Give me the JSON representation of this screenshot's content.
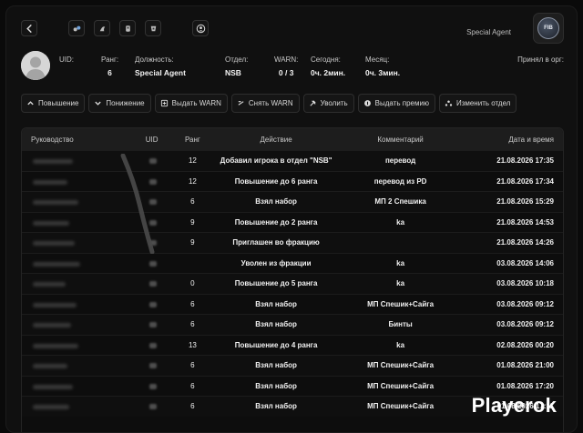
{
  "header": {
    "role_tag": "Special Agent",
    "logo_text": "FIB",
    "nav_icons": [
      "back-arrow-icon",
      "faction-icon-1",
      "faction-icon-2",
      "faction-icon-3",
      "faction-icon-4",
      "profile-icon"
    ]
  },
  "profile": {
    "uid_label": "UID:",
    "uid_value": "",
    "rank_label": "Ранг:",
    "rank_value": "6",
    "position_label": "Должность:",
    "position_value": "Special Agent",
    "dept_label": "Отдел:",
    "dept_value": "NSB",
    "warn_label": "WARN:",
    "warn_value": "0 / 3",
    "today_label": "Сегодня:",
    "today_value": "0ч. 2мин.",
    "month_label": "Месяц:",
    "month_value": "0ч. 3мин.",
    "joined_label": "Принял в орг:",
    "joined_value": ""
  },
  "actions": [
    {
      "label": "Повышение",
      "icon": "chevron-up-icon"
    },
    {
      "label": "Понижение",
      "icon": "chevron-down-icon"
    },
    {
      "label": "Выдать WARN",
      "icon": "warn-add-icon"
    },
    {
      "label": "Снять WARN",
      "icon": "warn-remove-icon"
    },
    {
      "label": "Уволить",
      "icon": "dismiss-icon"
    },
    {
      "label": "Выдать премию",
      "icon": "bonus-icon"
    },
    {
      "label": "Изменить отдел",
      "icon": "department-icon"
    }
  ],
  "table": {
    "headers": {
      "manager": "Руководство",
      "uid": "UID",
      "rank": "Ранг",
      "action": "Действие",
      "comment": "Комментарий",
      "date": "Дата и время"
    },
    "rows": [
      {
        "rank": "12",
        "action": "Добавил игрока в отдел \"NSB\"",
        "comment": "перевод",
        "date": "21.08.2026 17:35"
      },
      {
        "rank": "12",
        "action": "Повышение до 6 ранга",
        "comment": "перевод из PD",
        "date": "21.08.2026 17:34"
      },
      {
        "rank": "6",
        "action": "Взял набор",
        "comment": "МП 2 Спешика",
        "date": "21.08.2026 15:29"
      },
      {
        "rank": "9",
        "action": "Повышение до 2 ранга",
        "comment": "ka",
        "date": "21.08.2026 14:53"
      },
      {
        "rank": "9",
        "action": "Приглашен во фракцию",
        "comment": "",
        "date": "21.08.2026 14:26"
      },
      {
        "rank": "",
        "action": "Уволен из фракции",
        "comment": "ka",
        "date": "03.08.2026 14:06"
      },
      {
        "rank": "0",
        "action": "Повышение до 5 ранга",
        "comment": "ka",
        "date": "03.08.2026 10:18"
      },
      {
        "rank": "6",
        "action": "Взял набор",
        "comment": "МП Спешик+Сайга",
        "date": "03.08.2026 09:12"
      },
      {
        "rank": "6",
        "action": "Взял набор",
        "comment": "Бинты",
        "date": "03.08.2026 09:12"
      },
      {
        "rank": "13",
        "action": "Повышение до 4 ранга",
        "comment": "ka",
        "date": "02.08.2026 00:20"
      },
      {
        "rank": "6",
        "action": "Взял набор",
        "comment": "МП Спешик+Сайга",
        "date": "01.08.2026 21:00"
      },
      {
        "rank": "6",
        "action": "Взял набор",
        "comment": "МП Спешик+Сайга",
        "date": "01.08.2026 17:20"
      },
      {
        "rank": "6",
        "action": "Взял набор",
        "comment": "МП Спешик+Сайга",
        "date": "01.08.2026 17:11"
      }
    ]
  },
  "watermark": "Playerok"
}
